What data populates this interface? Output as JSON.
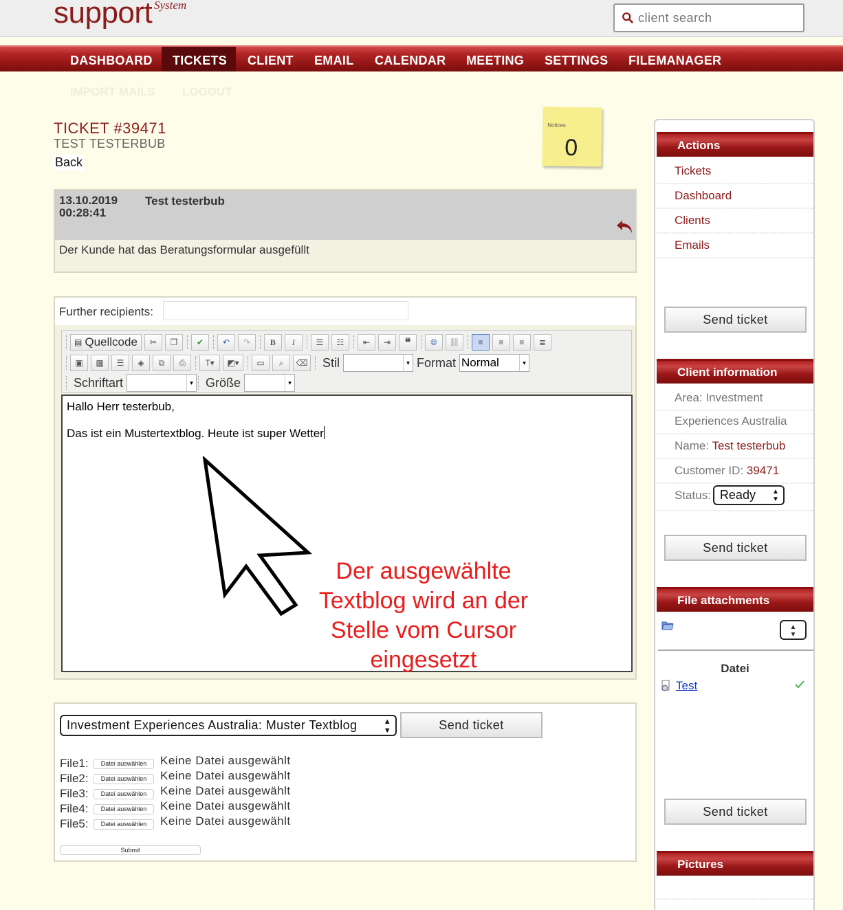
{
  "header": {
    "logo": "support",
    "logo_sup": "System",
    "search_placeholder": "client search"
  },
  "nav": {
    "items": [
      "DASHBOARD",
      "TICKETS",
      "CLIENT",
      "EMAIL",
      "CALENDAR",
      "MEETING",
      "SETTINGS",
      "FILEMANAGER"
    ],
    "active": "TICKETS",
    "sub_items": [
      "IMPORT MAILS",
      "LOGOUT"
    ]
  },
  "ticket": {
    "title": "TICKET #39471",
    "subtitle": "TEST TESTERBUB",
    "back_label": "Back"
  },
  "notice": {
    "label": "Notices",
    "count": "0",
    "color": "#f7ee8d"
  },
  "message": {
    "date": "13.10.2019",
    "time": "00:28:41",
    "author": "Test testerbub",
    "text": "Der Kunde hat das Beratungsformular ausgefüllt"
  },
  "editor": {
    "recipients_label": "Further recipients:",
    "recipients_value": "",
    "toolbar": {
      "source_label": "Quellcode",
      "style_label": "Stil",
      "style_value": "",
      "format_label": "Format",
      "format_value": "Normal",
      "font_label": "Schriftart",
      "font_value": "",
      "size_label": "Größe",
      "size_value": ""
    },
    "content": {
      "line1": "Hallo Herr testerbub,",
      "line2": "Das ist ein Mustertextblog. Heute ist super Wetter"
    },
    "annotation": "Der ausgewählte Textblog wird an der Stelle vom Cursor eingesetzt",
    "annotation_color": "#ea1c1c"
  },
  "form": {
    "template_value": "Investment Experiences Australia: Muster Textblog",
    "send_label": "Send ticket",
    "files": [
      {
        "label": "File1:",
        "button": "Datei auswählen",
        "status": "Keine Datei ausgewählt"
      },
      {
        "label": "File2:",
        "button": "Datei auswählen",
        "status": "Keine Datei ausgewählt"
      },
      {
        "label": "File3:",
        "button": "Datei auswählen",
        "status": "Keine Datei ausgewählt"
      },
      {
        "label": "File4:",
        "button": "Datei auswählen",
        "status": "Keine Datei ausgewählt"
      },
      {
        "label": "File5:",
        "button": "Datei auswählen",
        "status": "Keine Datei ausgewählt"
      }
    ],
    "submit_label": "Submit"
  },
  "sidebar": {
    "actions_title": "Actions",
    "actions": [
      "Tickets",
      "Dashboard",
      "Clients",
      "Emails"
    ],
    "send_label": "Send ticket",
    "client_title": "Client information",
    "area_label": "Area:",
    "area_value": "Investment",
    "area_value2": "Experiences Australia",
    "name_label": "Name:",
    "name_value": "Test testerbub",
    "customer_id_label": "Customer ID:",
    "customer_id_value": "39471",
    "status_label": "Status:",
    "status_value": "Ready",
    "attachments_title": "File attachments",
    "file_column": "Datei",
    "file_name": "Test",
    "pictures_title": "Pictures"
  },
  "colors": {
    "brand": "#8c1b1b",
    "nav_active": "#5a0a0a",
    "background": "#fefde9"
  }
}
